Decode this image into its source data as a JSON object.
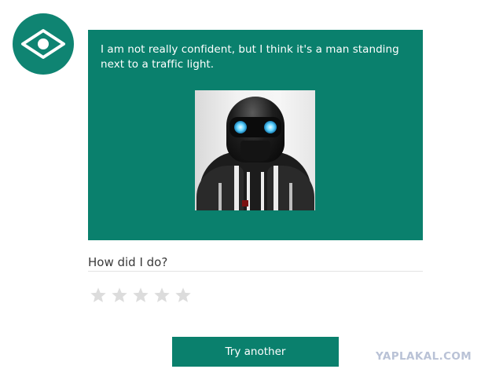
{
  "bot": {
    "icon": "eye-icon",
    "accent_color": "#0a806d"
  },
  "message": {
    "text": "I am not really confident, but I think it's a man standing next to a traffic light."
  },
  "photo": {
    "icon": "analyzed-photo"
  },
  "feedback": {
    "question": "How did I do?",
    "rating": {
      "value": 0,
      "max": 5,
      "star_color": "#dcdcdc"
    }
  },
  "actions": {
    "try_another_label": "Try another"
  },
  "watermark": {
    "text": "YAPLAKAL.COM"
  }
}
